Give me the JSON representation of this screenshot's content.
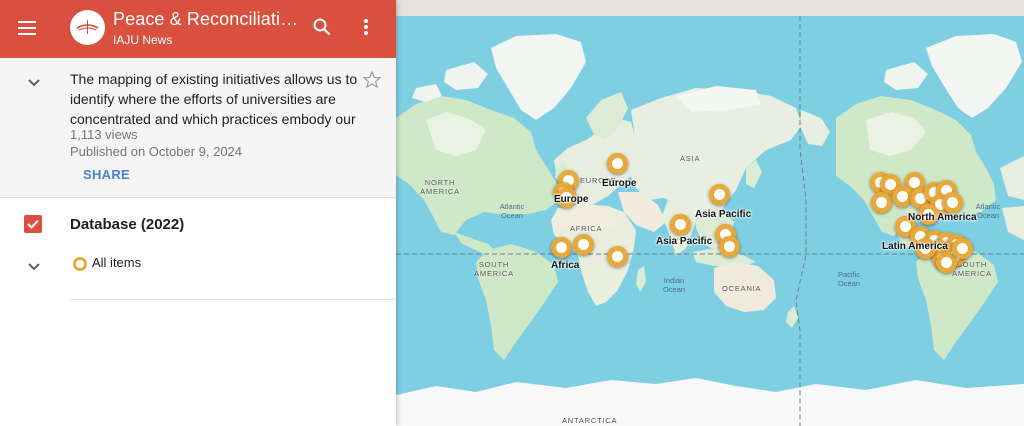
{
  "header": {
    "title": "Peace & Reconciliation",
    "subtitle": "IAJU News",
    "background": "#d9503f"
  },
  "description": {
    "text": "The mapping of existing initiatives allows us to identify where the efforts of universities are concentrated and which practices embody our",
    "views": "1,113 views",
    "published": "Published on October 9, 2024",
    "share_label": "SHARE"
  },
  "layer": {
    "name": "Database (2022)",
    "checked": true,
    "legend_label": "All items",
    "marker_color": "#e8a93a"
  },
  "map": {
    "ocean_color": "#7fcfe3",
    "land_color": "#cfe8c7",
    "region_labels": [
      "Europe",
      "Europe",
      "Asia Pacific",
      "Asia Pacific",
      "Africa",
      "North America",
      "Latin America"
    ],
    "geo_labels": [
      "NORTH AMERICA",
      "ASIA",
      "EUROPE",
      "AFRICA",
      "SOUTH AMERICA",
      "OCEANIA",
      "SOUTH AMERICA",
      "ANTARCTICA"
    ],
    "ocean_labels": [
      "Atlantic Ocean",
      "Indian Ocean",
      "Pacific Ocean",
      "Atlantic Ocean"
    ],
    "marker_count": 34
  }
}
